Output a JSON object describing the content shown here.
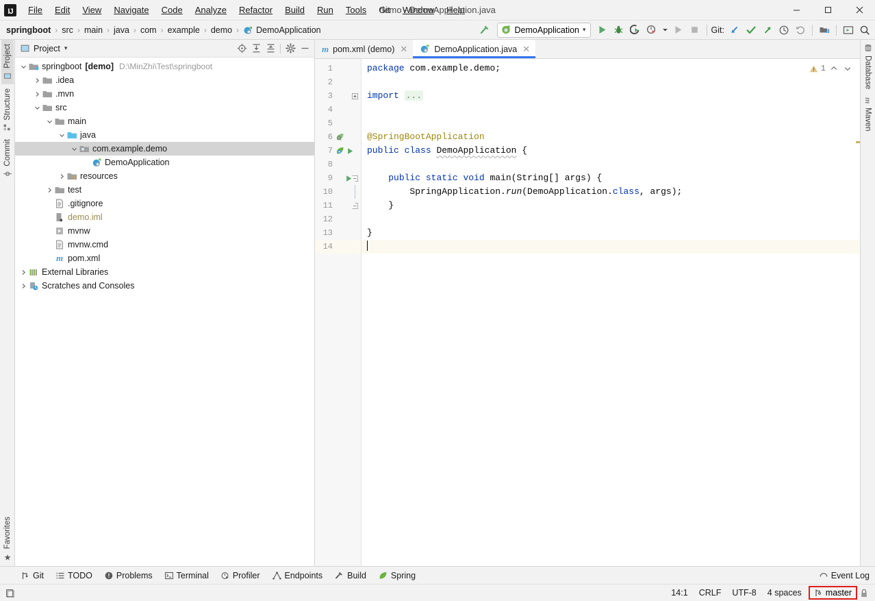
{
  "window": {
    "title": "demo - DemoApplication.java",
    "minimize_label": "─",
    "maximize_label": "□",
    "close_label": "✕"
  },
  "menubar": {
    "items": [
      {
        "label": "File",
        "mnemonic": "F"
      },
      {
        "label": "Edit",
        "mnemonic": "E"
      },
      {
        "label": "View",
        "mnemonic": "V"
      },
      {
        "label": "Navigate",
        "mnemonic": "N"
      },
      {
        "label": "Code",
        "mnemonic": "C"
      },
      {
        "label": "Analyze",
        "mnemonic": "z"
      },
      {
        "label": "Refactor",
        "mnemonic": "R"
      },
      {
        "label": "Build",
        "mnemonic": "B"
      },
      {
        "label": "Run",
        "mnemonic": "R"
      },
      {
        "label": "Tools",
        "mnemonic": "T"
      },
      {
        "label": "Git",
        "mnemonic": ""
      },
      {
        "label": "Window",
        "mnemonic": "W"
      },
      {
        "label": "Help",
        "mnemonic": "H"
      }
    ]
  },
  "navbar": {
    "breadcrumbs": [
      {
        "label": "springboot",
        "bold": true,
        "icon": ""
      },
      {
        "label": "src",
        "bold": false,
        "icon": ""
      },
      {
        "label": "main",
        "bold": false,
        "icon": ""
      },
      {
        "label": "java",
        "bold": false,
        "icon": ""
      },
      {
        "label": "com",
        "bold": false,
        "icon": ""
      },
      {
        "label": "example",
        "bold": false,
        "icon": ""
      },
      {
        "label": "demo",
        "bold": false,
        "icon": ""
      },
      {
        "label": "DemoApplication",
        "bold": false,
        "icon": "java-class-icon"
      }
    ],
    "separator": "›",
    "build_icon": "hammer-icon",
    "run_config": {
      "label": "DemoApplication",
      "icon": "spring-boot-run-config-icon",
      "chevron": "▾"
    },
    "actions": [
      {
        "name": "run-button",
        "icon": "play-icon",
        "enabled": true
      },
      {
        "name": "debug-button",
        "icon": "bug-icon",
        "enabled": true
      },
      {
        "name": "run-with-coverage-button",
        "icon": "coverage-icon",
        "enabled": true
      },
      {
        "name": "profile-button",
        "icon": "profiler-icon",
        "enabled": true
      },
      {
        "name": "profile-dropdown",
        "icon": "chevron-down-icon",
        "enabled": true
      },
      {
        "name": "rerun-button",
        "icon": "play-disabled-icon",
        "enabled": false
      },
      {
        "name": "stop-button",
        "icon": "stop-icon",
        "enabled": false
      }
    ],
    "git_label": "Git:",
    "git_actions": [
      {
        "name": "git-update-project-button",
        "icon": "update-arrow-icon"
      },
      {
        "name": "git-commit-button",
        "icon": "checkmark-icon"
      },
      {
        "name": "git-push-button",
        "icon": "push-arrow-icon"
      },
      {
        "name": "git-history-button",
        "icon": "clock-icon"
      },
      {
        "name": "git-rollback-button",
        "icon": "undo-icon"
      }
    ],
    "right_actions": [
      {
        "name": "project-structure-button",
        "icon": "project-structure-icon"
      },
      {
        "name": "run-anything-button",
        "icon": "terminal-screen-icon"
      },
      {
        "name": "search-everywhere-button",
        "icon": "search-icon"
      }
    ]
  },
  "left_strip": {
    "tabs": [
      {
        "label": "Project",
        "icon": "project-icon",
        "active": true
      },
      {
        "label": "Structure",
        "icon": "structure-icon",
        "active": false
      },
      {
        "label": "Commit",
        "icon": "commit-icon",
        "active": false
      }
    ],
    "bottom_tabs": [
      {
        "label": "Favorites",
        "icon": "star-icon",
        "active": false
      }
    ]
  },
  "right_strip": {
    "tabs": [
      {
        "label": "Database",
        "icon": "database-icon",
        "active": false
      },
      {
        "label": "Maven",
        "icon": "maven-icon",
        "active": false
      }
    ]
  },
  "project_panel": {
    "title": "Project",
    "title_chevron": "▾",
    "actions": [
      {
        "name": "select-opened-file-button",
        "icon": "locate-target-icon"
      },
      {
        "name": "expand-all-button",
        "icon": "expand-all-icon"
      },
      {
        "name": "collapse-all-button",
        "icon": "collapse-all-icon"
      },
      {
        "name": "panel-settings-button",
        "icon": "gear-icon"
      },
      {
        "name": "hide-panel-button",
        "icon": "minimize-icon"
      }
    ],
    "tree": [
      {
        "depth": 0,
        "chevron": "v",
        "icon": "module-folder-icon",
        "label": "springboot",
        "bold_suffix": "[demo]",
        "path": "D:\\MinZhi\\Test\\springboot",
        "selected": false
      },
      {
        "depth": 1,
        "chevron": ">",
        "icon": "folder-icon",
        "label": ".idea",
        "bold_suffix": "",
        "path": "",
        "selected": false
      },
      {
        "depth": 1,
        "chevron": ">",
        "icon": "folder-icon",
        "label": ".mvn",
        "bold_suffix": "",
        "path": "",
        "selected": false
      },
      {
        "depth": 1,
        "chevron": "v",
        "icon": "folder-icon",
        "label": "src",
        "bold_suffix": "",
        "path": "",
        "selected": false
      },
      {
        "depth": 2,
        "chevron": "v",
        "icon": "folder-icon",
        "label": "main",
        "bold_suffix": "",
        "path": "",
        "selected": false
      },
      {
        "depth": 3,
        "chevron": "v",
        "icon": "source-folder-icon",
        "label": "java",
        "bold_suffix": "",
        "path": "",
        "selected": false
      },
      {
        "depth": 4,
        "chevron": "v",
        "icon": "package-icon",
        "label": "com.example.demo",
        "bold_suffix": "",
        "path": "",
        "selected": true
      },
      {
        "depth": 5,
        "chevron": "",
        "icon": "spring-class-icon",
        "label": "DemoApplication",
        "bold_suffix": "",
        "path": "",
        "selected": false
      },
      {
        "depth": 3,
        "chevron": ">",
        "icon": "resources-folder-icon",
        "label": "resources",
        "bold_suffix": "",
        "path": "",
        "selected": false
      },
      {
        "depth": 2,
        "chevron": ">",
        "icon": "folder-icon",
        "label": "test",
        "bold_suffix": "",
        "path": "",
        "selected": false
      },
      {
        "depth": 2,
        "chevron": "",
        "icon": "file-icon",
        "label": ".gitignore",
        "bold_suffix": "",
        "path": "",
        "selected": false
      },
      {
        "depth": 2,
        "chevron": "",
        "icon": "iml-icon",
        "label": "demo.iml",
        "bold_suffix": "",
        "path": "",
        "selected": false,
        "muted": true
      },
      {
        "depth": 2,
        "chevron": "",
        "icon": "script-icon",
        "label": "mvnw",
        "bold_suffix": "",
        "path": "",
        "selected": false
      },
      {
        "depth": 2,
        "chevron": "",
        "icon": "file-icon",
        "label": "mvnw.cmd",
        "bold_suffix": "",
        "path": "",
        "selected": false
      },
      {
        "depth": 2,
        "chevron": "",
        "icon": "maven-pom-icon",
        "label": "pom.xml",
        "bold_suffix": "",
        "path": "",
        "selected": false
      },
      {
        "depth": 0,
        "chevron": ">",
        "icon": "libraries-icon",
        "label": "External Libraries",
        "bold_suffix": "",
        "path": "",
        "selected": false
      },
      {
        "depth": 0,
        "chevron": ">",
        "icon": "scratches-icon",
        "label": "Scratches and Consoles",
        "bold_suffix": "",
        "path": "",
        "selected": false
      }
    ]
  },
  "editor": {
    "tabs": [
      {
        "label": "pom.xml (demo)",
        "icon": "maven-pom-icon",
        "active": false,
        "close": "✕"
      },
      {
        "label": "DemoApplication.java",
        "icon": "spring-class-icon",
        "active": true,
        "close": "✕"
      }
    ],
    "inspection": {
      "icon": "warning-triangle-icon",
      "count": "1",
      "prev": "⌃",
      "next": "⌄"
    },
    "lines": [
      {
        "num": "1",
        "current": false,
        "gutter_icons": [],
        "fold": "",
        "html": "kw:package| com.example.demo;"
      },
      {
        "num": "2",
        "current": false,
        "gutter_icons": [],
        "fold": "",
        "html": ""
      },
      {
        "num": "3",
        "current": false,
        "gutter_icons": [],
        "fold": "plus",
        "html": "kw:import| fold:...|"
      },
      {
        "num": "4",
        "current": false,
        "gutter_icons": [],
        "fold": "",
        "html": ""
      },
      {
        "num": "5",
        "current": false,
        "gutter_icons": [],
        "fold": "",
        "html": ""
      },
      {
        "num": "6",
        "current": false,
        "gutter_icons": [
          "spring-bean-icon"
        ],
        "fold": "",
        "html": "ann:@SpringBootApplication|"
      },
      {
        "num": "7",
        "current": false,
        "gutter_icons": [
          "spring-boot-icon",
          "run-gutter-icon"
        ],
        "fold": "",
        "html": "kw:public| kw:class| wavy:DemoApplication| {"
      },
      {
        "num": "8",
        "current": false,
        "gutter_icons": [],
        "fold": "",
        "html": ""
      },
      {
        "num": "9",
        "current": false,
        "gutter_icons": [
          "run-gutter-icon"
        ],
        "fold": "minus",
        "html": "    kw:public| kw:static| kw:void| main(String[] args) {"
      },
      {
        "num": "10",
        "current": false,
        "gutter_icons": [],
        "fold": "bar",
        "html": "        SpringApplication.ital:run|(DemoApplication.kw:class|, args);"
      },
      {
        "num": "11",
        "current": false,
        "gutter_icons": [],
        "fold": "minus",
        "html": "    }"
      },
      {
        "num": "12",
        "current": false,
        "gutter_icons": [],
        "fold": "",
        "html": ""
      },
      {
        "num": "13",
        "current": false,
        "gutter_icons": [],
        "fold": "",
        "html": "}"
      },
      {
        "num": "14",
        "current": true,
        "gutter_icons": [],
        "fold": "",
        "html": "caret:|"
      }
    ],
    "code_text": {
      "l1": "package com.example.demo;",
      "l3": "import ...",
      "l6": "@SpringBootApplication",
      "l7": "public class DemoApplication {",
      "l9": "    public static void main(String[] args) {",
      "l10": "        SpringApplication.run(DemoApplication.class, args);",
      "l11": "    }",
      "l13": "}"
    }
  },
  "toolwindow_bar": {
    "items": [
      {
        "label": "Git",
        "icon": "git-branch-icon"
      },
      {
        "label": "TODO",
        "icon": "todo-list-icon"
      },
      {
        "label": "Problems",
        "icon": "problems-icon"
      },
      {
        "label": "Terminal",
        "icon": "terminal-icon"
      },
      {
        "label": "Profiler",
        "icon": "profiler-icon"
      },
      {
        "label": "Endpoints",
        "icon": "endpoints-icon"
      },
      {
        "label": "Build",
        "icon": "hammer-icon"
      },
      {
        "label": "Spring",
        "icon": "spring-leaf-icon"
      }
    ],
    "event_log": {
      "label": "Event Log",
      "icon": "event-log-icon"
    }
  },
  "statusbar": {
    "left_icon": "memory-indicator-icon",
    "items": [
      {
        "name": "caret-position",
        "label": "14:1"
      },
      {
        "name": "line-separator",
        "label": "CRLF"
      },
      {
        "name": "file-encoding",
        "label": "UTF-8"
      },
      {
        "name": "indent-size",
        "label": "4 spaces"
      }
    ],
    "branch": {
      "label": "master",
      "icon": "git-branch-icon",
      "highlight_color": "#E21B1B"
    },
    "lock_icon": "lock-icon"
  },
  "colors": {
    "accent_blue": "#3574F0",
    "keyword_blue": "#0033B3",
    "annotation_gold": "#9E880D",
    "spring_green": "#6DB33F",
    "selection_gray": "#D4D4D4",
    "current_line": "#FCFAF0",
    "highlight_red": "#E21B1B"
  }
}
